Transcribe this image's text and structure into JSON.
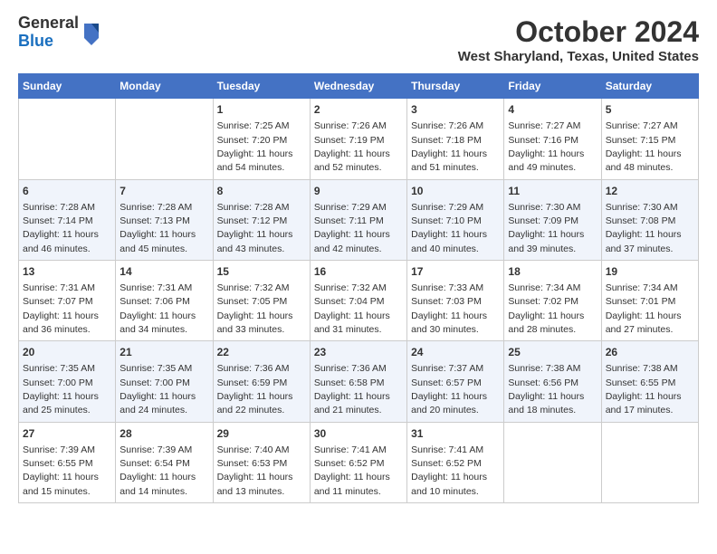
{
  "header": {
    "logo_line1": "General",
    "logo_line2": "Blue",
    "title": "October 2024",
    "subtitle": "West Sharyland, Texas, United States"
  },
  "days_of_week": [
    "Sunday",
    "Monday",
    "Tuesday",
    "Wednesday",
    "Thursday",
    "Friday",
    "Saturday"
  ],
  "weeks": [
    [
      {
        "day": "",
        "data": ""
      },
      {
        "day": "",
        "data": ""
      },
      {
        "day": "1",
        "data": "Sunrise: 7:25 AM\nSunset: 7:20 PM\nDaylight: 11 hours and 54 minutes."
      },
      {
        "day": "2",
        "data": "Sunrise: 7:26 AM\nSunset: 7:19 PM\nDaylight: 11 hours and 52 minutes."
      },
      {
        "day": "3",
        "data": "Sunrise: 7:26 AM\nSunset: 7:18 PM\nDaylight: 11 hours and 51 minutes."
      },
      {
        "day": "4",
        "data": "Sunrise: 7:27 AM\nSunset: 7:16 PM\nDaylight: 11 hours and 49 minutes."
      },
      {
        "day": "5",
        "data": "Sunrise: 7:27 AM\nSunset: 7:15 PM\nDaylight: 11 hours and 48 minutes."
      }
    ],
    [
      {
        "day": "6",
        "data": "Sunrise: 7:28 AM\nSunset: 7:14 PM\nDaylight: 11 hours and 46 minutes."
      },
      {
        "day": "7",
        "data": "Sunrise: 7:28 AM\nSunset: 7:13 PM\nDaylight: 11 hours and 45 minutes."
      },
      {
        "day": "8",
        "data": "Sunrise: 7:28 AM\nSunset: 7:12 PM\nDaylight: 11 hours and 43 minutes."
      },
      {
        "day": "9",
        "data": "Sunrise: 7:29 AM\nSunset: 7:11 PM\nDaylight: 11 hours and 42 minutes."
      },
      {
        "day": "10",
        "data": "Sunrise: 7:29 AM\nSunset: 7:10 PM\nDaylight: 11 hours and 40 minutes."
      },
      {
        "day": "11",
        "data": "Sunrise: 7:30 AM\nSunset: 7:09 PM\nDaylight: 11 hours and 39 minutes."
      },
      {
        "day": "12",
        "data": "Sunrise: 7:30 AM\nSunset: 7:08 PM\nDaylight: 11 hours and 37 minutes."
      }
    ],
    [
      {
        "day": "13",
        "data": "Sunrise: 7:31 AM\nSunset: 7:07 PM\nDaylight: 11 hours and 36 minutes."
      },
      {
        "day": "14",
        "data": "Sunrise: 7:31 AM\nSunset: 7:06 PM\nDaylight: 11 hours and 34 minutes."
      },
      {
        "day": "15",
        "data": "Sunrise: 7:32 AM\nSunset: 7:05 PM\nDaylight: 11 hours and 33 minutes."
      },
      {
        "day": "16",
        "data": "Sunrise: 7:32 AM\nSunset: 7:04 PM\nDaylight: 11 hours and 31 minutes."
      },
      {
        "day": "17",
        "data": "Sunrise: 7:33 AM\nSunset: 7:03 PM\nDaylight: 11 hours and 30 minutes."
      },
      {
        "day": "18",
        "data": "Sunrise: 7:34 AM\nSunset: 7:02 PM\nDaylight: 11 hours and 28 minutes."
      },
      {
        "day": "19",
        "data": "Sunrise: 7:34 AM\nSunset: 7:01 PM\nDaylight: 11 hours and 27 minutes."
      }
    ],
    [
      {
        "day": "20",
        "data": "Sunrise: 7:35 AM\nSunset: 7:00 PM\nDaylight: 11 hours and 25 minutes."
      },
      {
        "day": "21",
        "data": "Sunrise: 7:35 AM\nSunset: 7:00 PM\nDaylight: 11 hours and 24 minutes."
      },
      {
        "day": "22",
        "data": "Sunrise: 7:36 AM\nSunset: 6:59 PM\nDaylight: 11 hours and 22 minutes."
      },
      {
        "day": "23",
        "data": "Sunrise: 7:36 AM\nSunset: 6:58 PM\nDaylight: 11 hours and 21 minutes."
      },
      {
        "day": "24",
        "data": "Sunrise: 7:37 AM\nSunset: 6:57 PM\nDaylight: 11 hours and 20 minutes."
      },
      {
        "day": "25",
        "data": "Sunrise: 7:38 AM\nSunset: 6:56 PM\nDaylight: 11 hours and 18 minutes."
      },
      {
        "day": "26",
        "data": "Sunrise: 7:38 AM\nSunset: 6:55 PM\nDaylight: 11 hours and 17 minutes."
      }
    ],
    [
      {
        "day": "27",
        "data": "Sunrise: 7:39 AM\nSunset: 6:55 PM\nDaylight: 11 hours and 15 minutes."
      },
      {
        "day": "28",
        "data": "Sunrise: 7:39 AM\nSunset: 6:54 PM\nDaylight: 11 hours and 14 minutes."
      },
      {
        "day": "29",
        "data": "Sunrise: 7:40 AM\nSunset: 6:53 PM\nDaylight: 11 hours and 13 minutes."
      },
      {
        "day": "30",
        "data": "Sunrise: 7:41 AM\nSunset: 6:52 PM\nDaylight: 11 hours and 11 minutes."
      },
      {
        "day": "31",
        "data": "Sunrise: 7:41 AM\nSunset: 6:52 PM\nDaylight: 11 hours and 10 minutes."
      },
      {
        "day": "",
        "data": ""
      },
      {
        "day": "",
        "data": ""
      }
    ]
  ]
}
